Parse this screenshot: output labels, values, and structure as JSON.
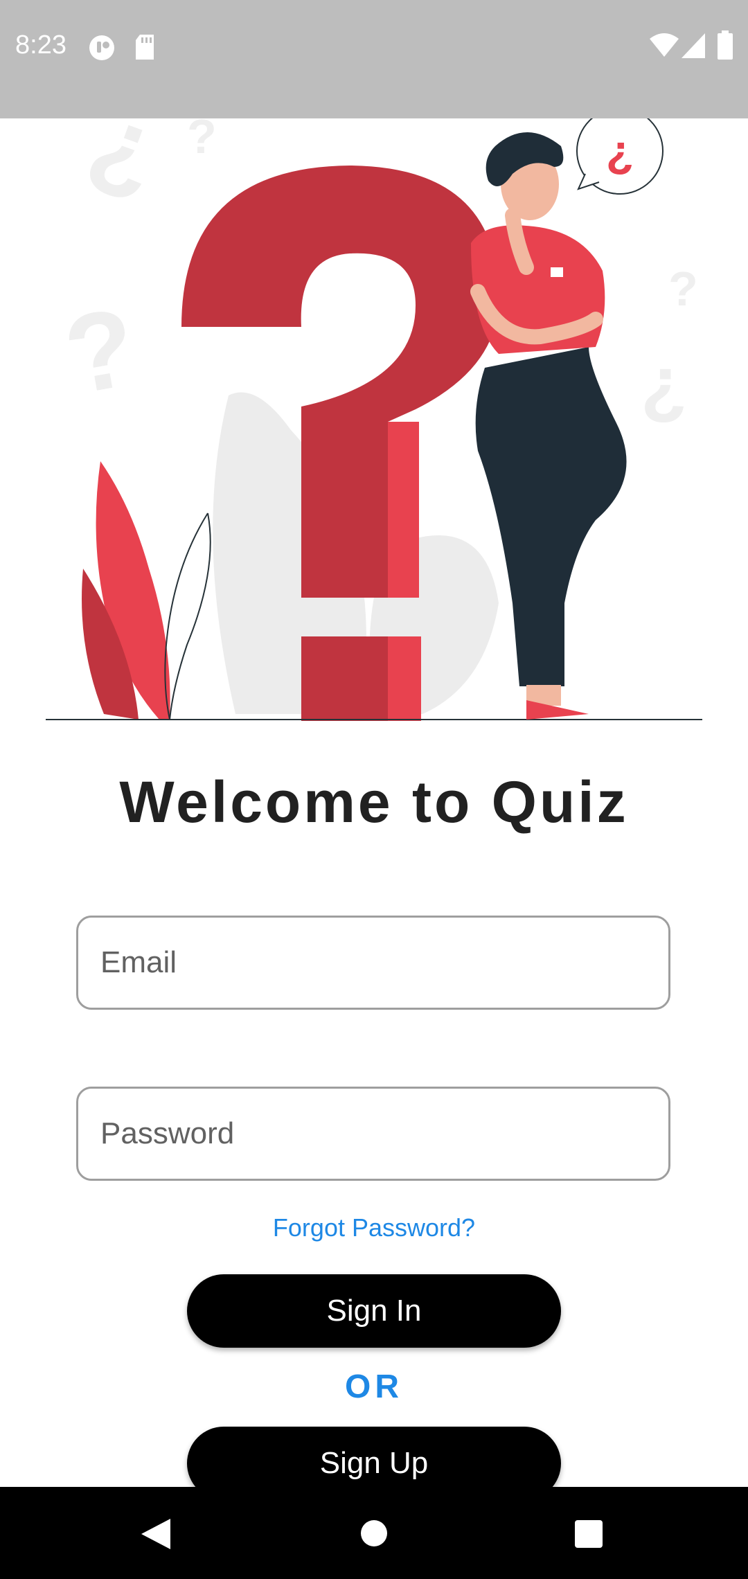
{
  "status_bar": {
    "time": "8:23",
    "icons": [
      "app-notification-icon",
      "sd-card-icon",
      "wifi-icon",
      "signal-icon",
      "battery-icon"
    ]
  },
  "illustration": {
    "description_icon": "thinking-person-question-mark-illustration",
    "bubble_glyph": "¿",
    "accent": "#e8424f",
    "dark_accent": "#c0343f"
  },
  "login": {
    "title": "Welcome to Quiz",
    "email_placeholder": "Email",
    "password_placeholder": "Password",
    "forgot_password": "Forgot Password?",
    "sign_in": "Sign In",
    "or": "OR",
    "sign_up": "Sign Up"
  },
  "colors": {
    "link": "#1e88e5",
    "button": "#000000",
    "status_bar": "#bdbdbd"
  },
  "nav_bar": {
    "icons": [
      "back-icon",
      "home-icon",
      "recents-icon"
    ]
  }
}
